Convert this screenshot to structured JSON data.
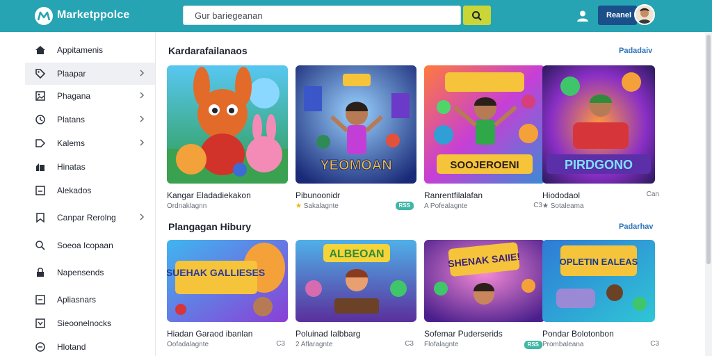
{
  "header": {
    "brand": "Marketppolce",
    "search_value": "Gur bariegeanan",
    "account_label": "Reanel"
  },
  "sidebar": {
    "items": [
      {
        "label": "Appitamenis",
        "icon": "home-icon",
        "chevron": false
      },
      {
        "label": "Plaapar",
        "icon": "tag-icon",
        "chevron": true
      },
      {
        "label": "Phagana",
        "icon": "image-icon",
        "chevron": true
      },
      {
        "label": "Platans",
        "icon": "clock-icon",
        "chevron": true
      },
      {
        "label": "Kalems",
        "icon": "label-icon",
        "chevron": true
      },
      {
        "label": "Hinatas",
        "icon": "building-icon",
        "chevron": false
      },
      {
        "label": "Alekados",
        "icon": "box-icon",
        "chevron": false
      },
      {
        "label": "Canpar Rerolng",
        "icon": "bookmark-icon",
        "chevron": true
      },
      {
        "label": "Soeoa Icopaan",
        "icon": "search-icon",
        "chevron": false
      },
      {
        "label": "Napensends",
        "icon": "lock-icon",
        "chevron": false
      },
      {
        "label": "Apliasnars",
        "icon": "checkbox-icon",
        "chevron": false
      },
      {
        "label": "Sieoonelnocks",
        "icon": "dropdown-icon",
        "chevron": false
      },
      {
        "label": "Hlotand",
        "icon": "circle-icon",
        "chevron": false
      }
    ]
  },
  "sections": [
    {
      "title": "Kardarafailanaos",
      "link": "Padadaiv",
      "cards": [
        {
          "title": "Kangar Eladadiekakon",
          "sub": "Ordnaklagnn",
          "tag": "",
          "tag_style": "none",
          "star": false,
          "art": "ART 1"
        },
        {
          "title": "Pibunoonidr",
          "sub": "Sakalagnte",
          "tag": "RSS",
          "tag_style": "pill",
          "star": true,
          "art": "YEOMOAN"
        },
        {
          "title": "Ranrentfilalafan",
          "sub": "A Pofealagnte",
          "tag": "C3",
          "tag_style": "plain",
          "star": false,
          "art": "SOOJEROENI"
        },
        {
          "title": "Hiododaol",
          "sub": "Sotaleama",
          "tag": "Can",
          "tag_style": "plain",
          "star": true,
          "art": "PIRDGONO"
        }
      ]
    },
    {
      "title": "Plangagan Hibury",
      "link": "Padarhav",
      "cards": [
        {
          "title": "Hiadan Garaod ibanlan",
          "sub": "Oofadalagnte",
          "tag": "C3",
          "tag_style": "plain",
          "star": false,
          "art": "SUEHAK GALLIESES"
        },
        {
          "title": "Poluinad Ialbbarg",
          "sub": "2 Aflaragnte",
          "tag": "C3",
          "tag_style": "plain",
          "star": false,
          "art": "ALBEOAN"
        },
        {
          "title": "Sofemar Puderserids",
          "sub": "Flofalagnte",
          "tag": "RSS",
          "tag_style": "pill",
          "star": false,
          "art": "SHENAK SAIIE!"
        },
        {
          "title": "Pondar Bolotonbon",
          "sub": "Prombaleana",
          "tag": "C3",
          "tag_style": "plain",
          "star": false,
          "art": "OPLETIN EALEAS"
        }
      ]
    }
  ],
  "colors": {
    "header": "#26a4b4",
    "search_button": "#c9d635",
    "account_button": "#1a4f8a",
    "link": "#2a73b8",
    "pill": "#3fb7a6",
    "star": "#f2b40c"
  }
}
